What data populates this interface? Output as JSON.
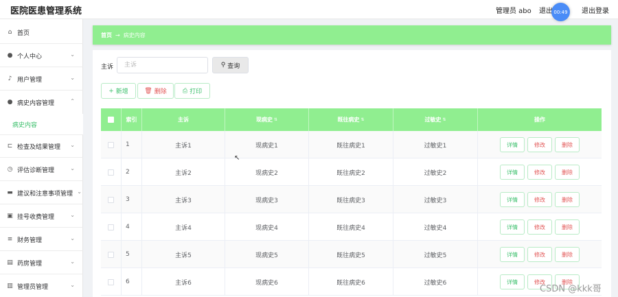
{
  "header": {
    "title": "医院医患管理系统",
    "admin": "管理员 abo",
    "logout_a": "退出",
    "logout_b": "退出登录",
    "timer": "00:49"
  },
  "sidebar": {
    "items": [
      {
        "label": "首页",
        "icon": "home-icon",
        "glyph": "⌂"
      },
      {
        "label": "个人中心",
        "icon": "user-icon",
        "glyph": "●"
      },
      {
        "label": "用户管理",
        "icon": "microphone-icon",
        "glyph": "♪"
      },
      {
        "label": "病史内容管理",
        "icon": "user-icon",
        "glyph": "●"
      },
      {
        "label": "检查及结果管理",
        "icon": "crop-icon",
        "glyph": "⊏"
      },
      {
        "label": "评估诊断管理",
        "icon": "clock-icon",
        "glyph": "◷"
      },
      {
        "label": "建议和注意事项管理",
        "icon": "bank-icon",
        "glyph": "▬"
      },
      {
        "label": "挂号收费管理",
        "icon": "ticket-icon",
        "glyph": "▣"
      },
      {
        "label": "财务管理",
        "icon": "menu-icon",
        "glyph": "≡"
      },
      {
        "label": "药房管理",
        "icon": "box-icon",
        "glyph": "▤"
      },
      {
        "label": "管理员管理",
        "icon": "chart-icon",
        "glyph": "▥"
      }
    ],
    "sub_item": "病史内容"
  },
  "breadcrumb": {
    "home": "首页",
    "arrow": "→",
    "current": "病史内容"
  },
  "search": {
    "label": "主诉",
    "placeholder": "主诉",
    "button": "查询"
  },
  "toolbar": {
    "add": "新增",
    "delete": "删除",
    "print": "打印"
  },
  "table": {
    "headers": {
      "index": "索引",
      "complaint": "主诉",
      "present": "现病史",
      "past": "既往病史",
      "allergy": "过敏史",
      "ops": "操作"
    },
    "rows": [
      {
        "index": "1",
        "complaint": "主诉1",
        "present": "现病史1",
        "past": "既往病史1",
        "allergy": "过敏史1"
      },
      {
        "index": "2",
        "complaint": "主诉2",
        "present": "现病史2",
        "past": "既往病史2",
        "allergy": "过敏史2"
      },
      {
        "index": "3",
        "complaint": "主诉3",
        "present": "现病史3",
        "past": "既往病史3",
        "allergy": "过敏史3"
      },
      {
        "index": "4",
        "complaint": "主诉4",
        "present": "现病史4",
        "past": "既往病史4",
        "allergy": "过敏史4"
      },
      {
        "index": "5",
        "complaint": "主诉5",
        "present": "现病史5",
        "past": "既往病史5",
        "allergy": "过敏史5"
      },
      {
        "index": "6",
        "complaint": "主诉6",
        "present": "现病史6",
        "past": "既往病史6",
        "allergy": "过敏史6"
      }
    ],
    "actions": {
      "detail": "详情",
      "edit": "修改",
      "remove": "删除"
    }
  },
  "watermark": "CSDN @kkk哥",
  "colors": {
    "accent": "#90ee90",
    "accent_text": "#3bbf6b",
    "danger": "#e25656",
    "timer": "#4a8cf7"
  }
}
